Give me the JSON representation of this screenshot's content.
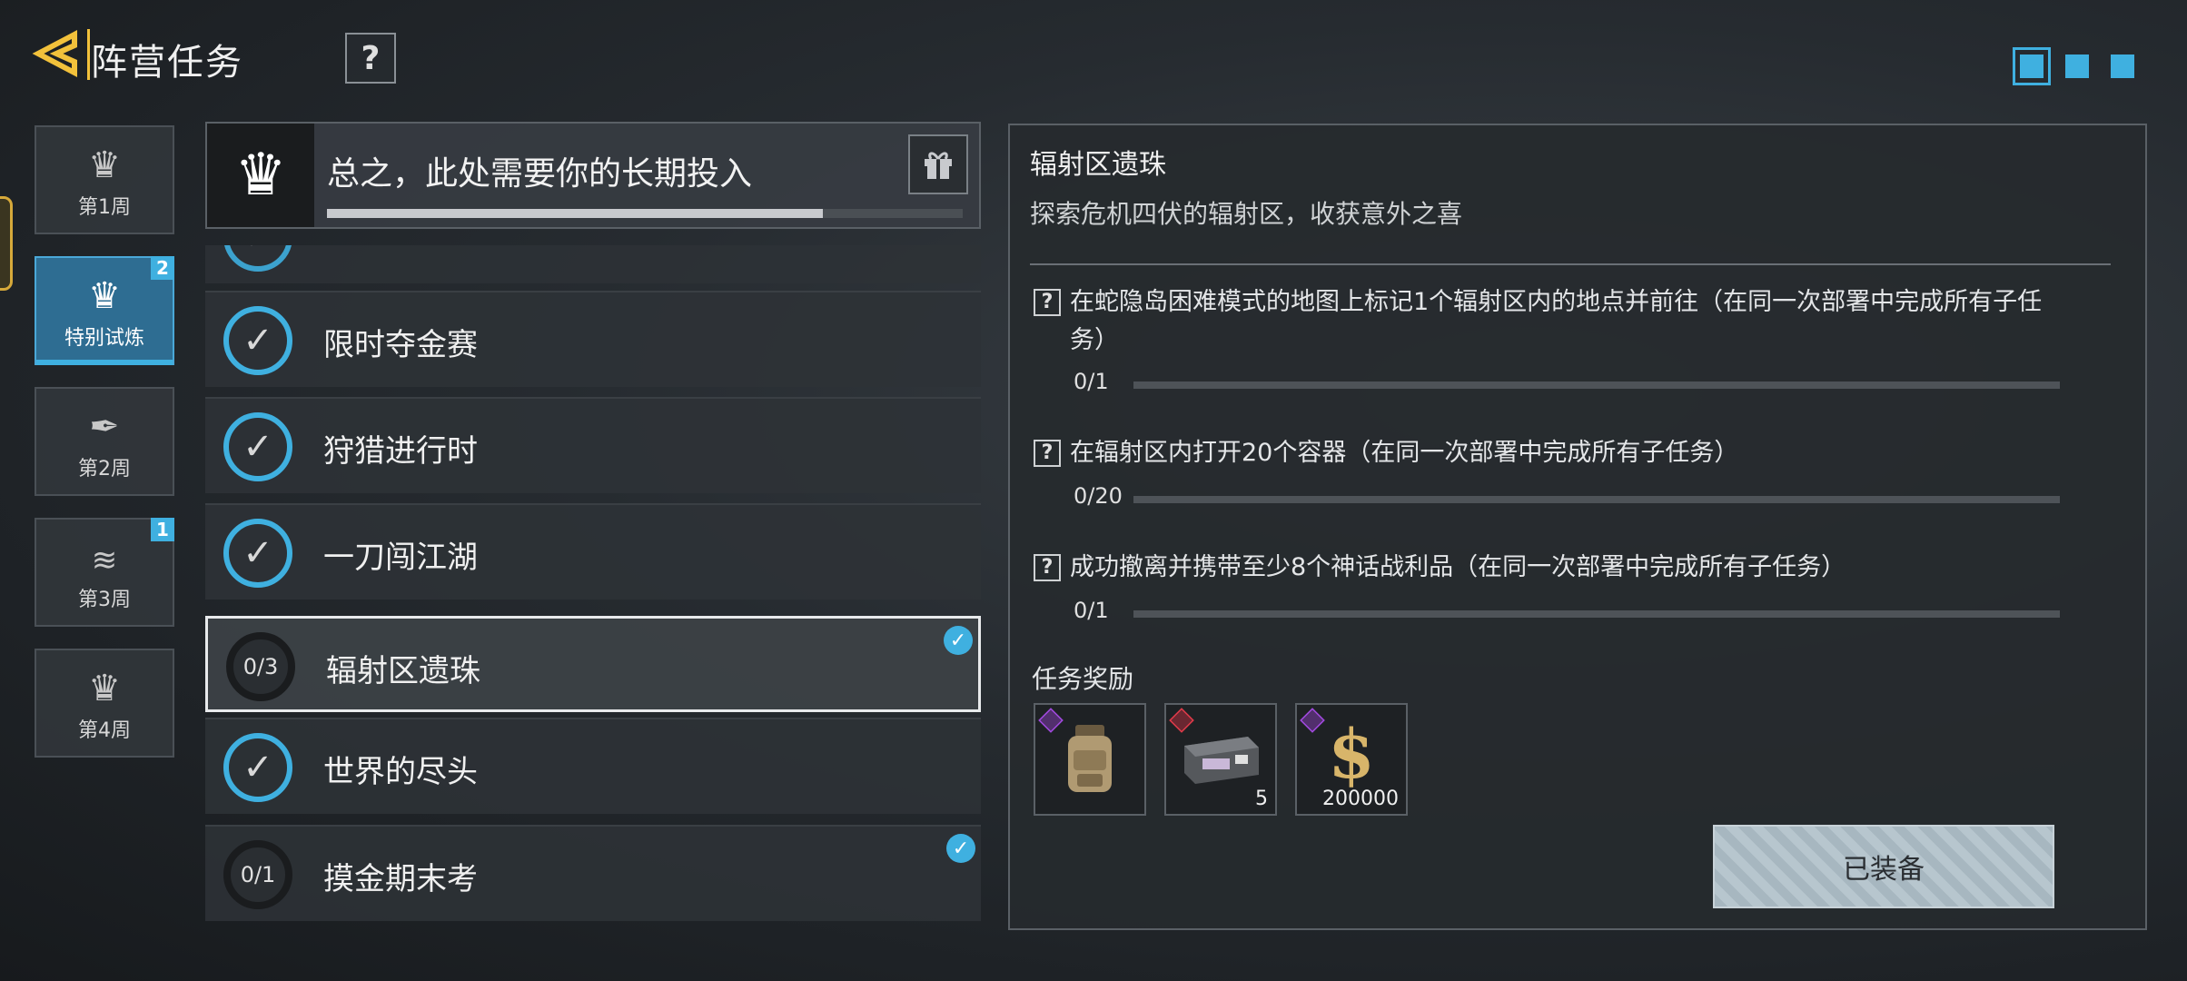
{
  "header": {
    "title": "阵营任务",
    "help_label": "?",
    "page_dots": 3,
    "active_page": 1
  },
  "sidebar": {
    "weeks": [
      {
        "label": "第1周",
        "icon": "crown-emblem-icon",
        "badge": ""
      },
      {
        "label": "特别试炼",
        "icon": "crown-emblem-icon",
        "badge": "2",
        "active": true
      },
      {
        "label": "第2周",
        "icon": "calligraphy-emblem-icon",
        "badge": ""
      },
      {
        "label": "第3周",
        "icon": "wings-emblem-icon",
        "badge": "1"
      },
      {
        "label": "第4周",
        "icon": "crown-emblem-icon",
        "badge": ""
      }
    ]
  },
  "mission_header": {
    "title": "总之，此处需要你的长期投入",
    "progress_fraction": 0.78,
    "emblem": "crown-emblem-icon",
    "gift_icon": "gift-icon"
  },
  "tasks": [
    {
      "name": "限时夺金赛",
      "status": "complete",
      "progress": "",
      "tracked": false
    },
    {
      "name": "狩猎进行时",
      "status": "complete",
      "progress": "",
      "tracked": false
    },
    {
      "name": "一刀闯江湖",
      "status": "complete",
      "progress": "",
      "tracked": false
    },
    {
      "name": "辐射区遗珠",
      "status": "in-progress",
      "progress": "0/3",
      "tracked": true,
      "selected": true
    },
    {
      "name": "世界的尽头",
      "status": "complete",
      "progress": "",
      "tracked": false
    },
    {
      "name": "摸金期末考",
      "status": "in-progress",
      "progress": "0/1",
      "tracked": true
    }
  ],
  "detail": {
    "title": "辐射区遗珠",
    "description": "探索危机四伏的辐射区，收获意外之喜",
    "objectives": [
      {
        "text": "在蛇隐岛困难模式的地图上标记1个辐射区内的地点并前往（在同一次部署中完成所有子任务）",
        "count": "0/1"
      },
      {
        "text": "在辐射区内打开20个容器（在同一次部署中完成所有子任务）",
        "count": "0/20"
      },
      {
        "text": "成功撤离并携带至少8个神话战利品（在同一次部署中完成所有子任务）",
        "count": "0/1"
      }
    ],
    "rewards_label": "任务奖励",
    "rewards": [
      {
        "name": "backpack-item",
        "rarity": "purple",
        "qty": ""
      },
      {
        "name": "weapon-crate-item",
        "rarity": "red",
        "qty": "5"
      },
      {
        "name": "currency-item",
        "rarity": "purple",
        "qty": "200000"
      }
    ],
    "equip_label": "已装备"
  },
  "colors": {
    "accent": "#3fb0e0",
    "back_arrow": "#f2c13b",
    "rarity_purple": "#a24ae0",
    "rarity_red": "#e03b4a"
  }
}
